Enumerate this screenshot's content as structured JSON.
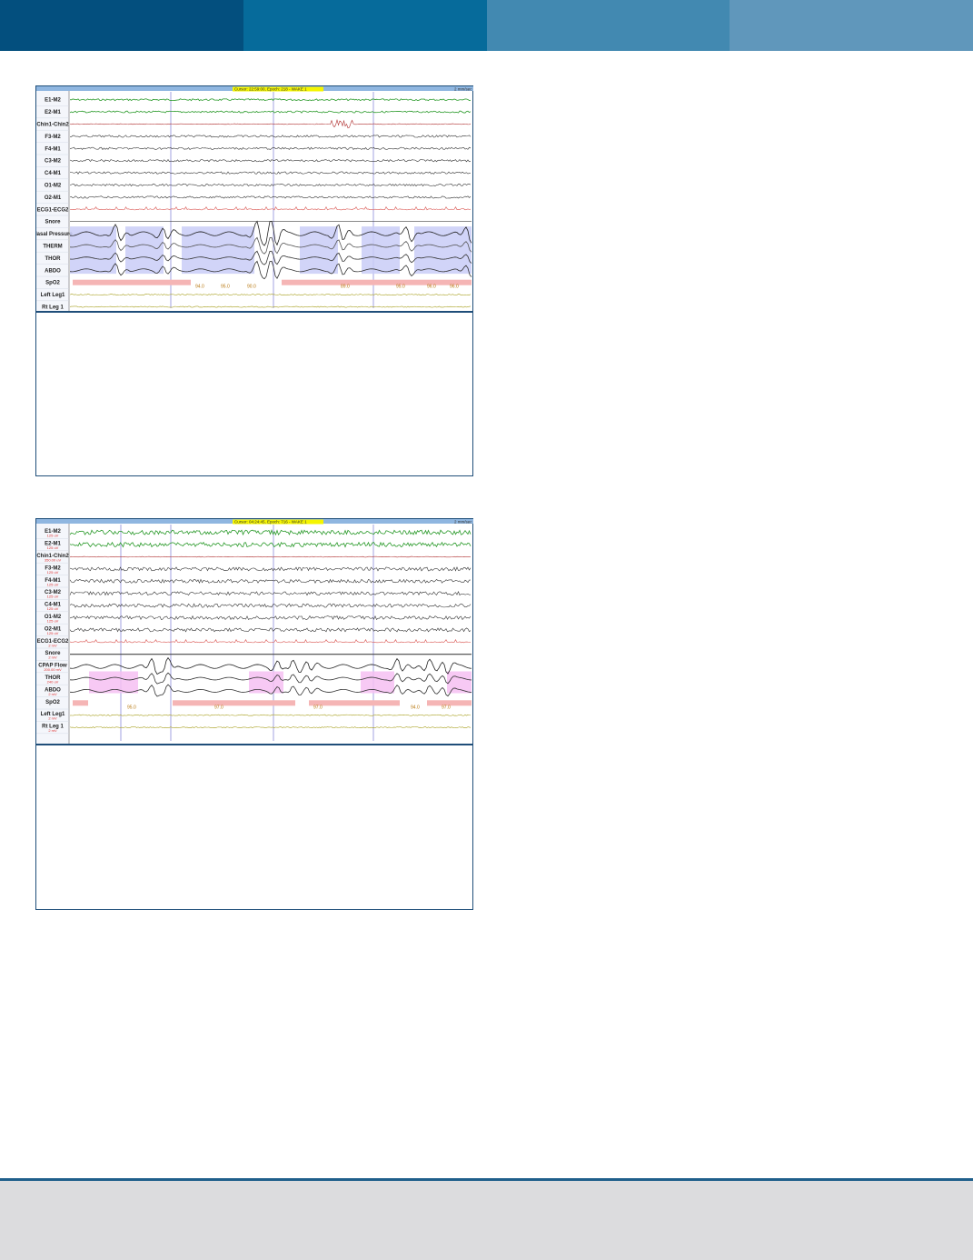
{
  "colors": {
    "header": [
      "#034f7e",
      "#066b9b",
      "#4289b1",
      "#6097bb"
    ],
    "frame": "#1f4e79",
    "footer": "#dcdcde",
    "footer_rule": "#1f5f8b",
    "eeg_green": "#2a9a2a",
    "trace": "#333333",
    "ecg": "#d9534f",
    "legs": "#a8a020",
    "shade_blue": "#c9cdf7",
    "shade_pink": "#f6c0f2",
    "shade_red": "#f5b5b5",
    "cursor_bg": "#f5f500"
  },
  "figure1": {
    "cursor_label": "Cursor: 22:59:00, Epoch: 218 - WAKE 1",
    "speed": "2 mm/sec",
    "channels": [
      "E1-M2",
      "E2-M1",
      "Chin1-Chin2",
      "F3-M2",
      "F4-M1",
      "C3-M2",
      "C4-M1",
      "O1-M2",
      "O2-M1",
      "ECG1-ECG2",
      "Snore",
      "Nasal Pressure",
      "THERM",
      "THOR",
      "ABDO",
      "SpO2",
      "Left Leg1",
      "Rt Leg 1"
    ],
    "spo2_values": [
      "94.0",
      "95.0",
      "90.0",
      "89.0",
      "95.0",
      "96.0",
      "96.0"
    ]
  },
  "figure2": {
    "cursor_label": "Cursor: 04:24:45, Epoch: 716 - WAKE 1",
    "speed": "2 mm/sec",
    "channels": [
      {
        "name": "E1-M2",
        "scale": "125 uV"
      },
      {
        "name": "E2-M1",
        "scale": "125 uV"
      },
      {
        "name": "Chin1-Chin2",
        "scale": "350.00 uV"
      },
      {
        "name": "F3-M2",
        "scale": "125 uV"
      },
      {
        "name": "F4-M1",
        "scale": "125 uV"
      },
      {
        "name": "C3-M2",
        "scale": "125 uV"
      },
      {
        "name": "C4-M1",
        "scale": "125 uV"
      },
      {
        "name": "O1-M2",
        "scale": "125 uV"
      },
      {
        "name": "O2-M1",
        "scale": "125 uV"
      },
      {
        "name": "ECG1-ECG2",
        "scale": "2 mV"
      },
      {
        "name": "Snore",
        "scale": "2 mV"
      },
      {
        "name": "CPAP Flow",
        "scale": "200.00 mV"
      },
      {
        "name": "THOR",
        "scale": "240 uV"
      },
      {
        "name": "ABDO",
        "scale": "2 mV"
      },
      {
        "name": "SpO2",
        "scale": ""
      },
      {
        "name": "Left Leg1",
        "scale": "2 mV"
      },
      {
        "name": "Rt Leg 1",
        "scale": "2 mV"
      }
    ],
    "spo2_values": [
      "95.0",
      "97.0",
      "97.0",
      "94.0",
      "97.0"
    ]
  }
}
